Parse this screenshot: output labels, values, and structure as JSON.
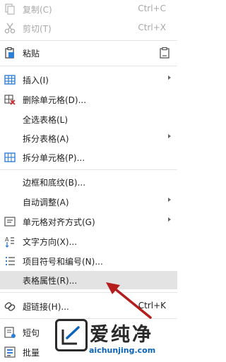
{
  "menu": {
    "items": [
      {
        "label": "复制(C)",
        "shortcut": "Ctrl+C",
        "disabled": true,
        "icon": "copy-icon"
      },
      {
        "label": "剪切(T)",
        "shortcut": "Ctrl+X",
        "disabled": true,
        "icon": "scissors-icon"
      },
      {
        "label": "粘贴",
        "icon": "paste-icon",
        "right_icon": "paste-options-icon"
      },
      {
        "label": "插入(I)",
        "icon": "table-insert-icon",
        "submenu": true
      },
      {
        "label": "删除单元格(D)...",
        "icon": "delete-cells-icon"
      },
      {
        "label": "全选表格(L)"
      },
      {
        "label": "拆分表格(A)",
        "submenu": true
      },
      {
        "label": "拆分单元格(P)...",
        "icon": "split-cells-icon"
      },
      {
        "label": "边框和底纹(B)..."
      },
      {
        "label": "自动调整(A)",
        "submenu": true
      },
      {
        "label": "单元格对齐方式(G)",
        "icon": "cell-align-icon",
        "submenu": true
      },
      {
        "label": "文字方向(X)...",
        "icon": "text-direction-icon"
      },
      {
        "label": "项目符号和编号(N)...",
        "icon": "bullets-numbering-icon"
      },
      {
        "label": "表格属性(R)...",
        "highlighted": true
      },
      {
        "label": "超链接(H)...",
        "shortcut": "Ctrl+K",
        "icon": "hyperlink-icon"
      },
      {
        "label": "短句",
        "icon": "phrase-icon"
      },
      {
        "label": "批量",
        "icon": "batch-icon"
      }
    ]
  },
  "annotation": {
    "color": "#b51c1c"
  },
  "watermark": {
    "title": "爱纯净",
    "url": "aichunjing.com",
    "url_color": "#0b64b9"
  }
}
